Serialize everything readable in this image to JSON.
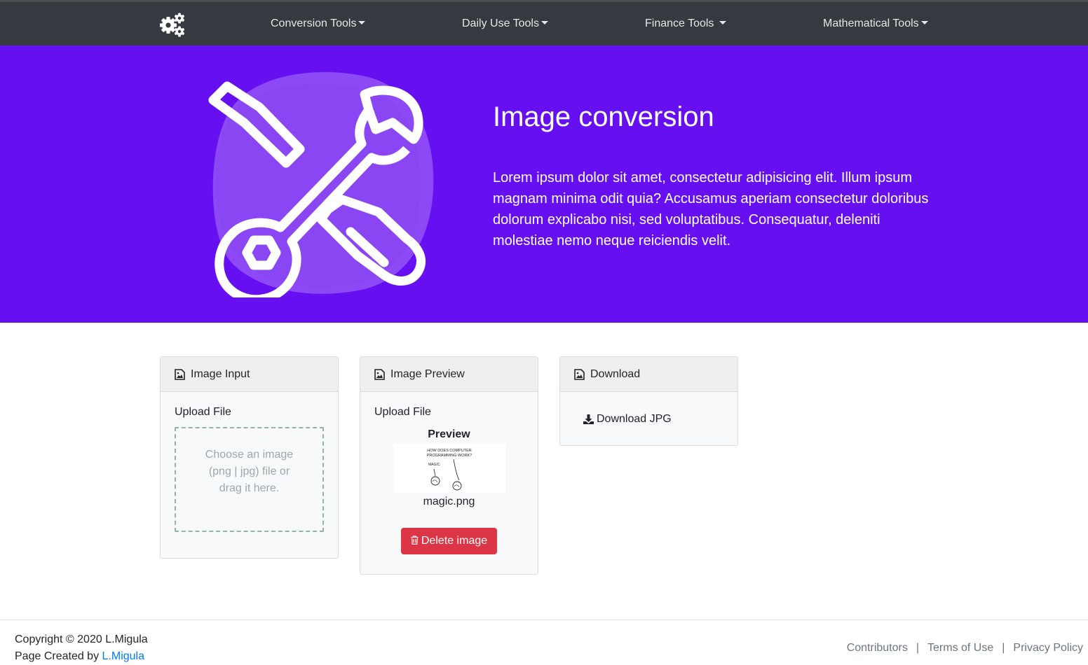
{
  "nav": {
    "items": [
      {
        "label": "Conversion Tools"
      },
      {
        "label": "Daily Use Tools"
      },
      {
        "label": "Finance Tools "
      },
      {
        "label": "Mathematical Tools"
      }
    ]
  },
  "hero": {
    "title": "Image conversion",
    "text": "Lorem ipsum dolor sit amet, consectetur adipisicing elit. Illum ipsum magnam minima odit quia? Accusamus aperiam consectetur doloribus dolorum explicabo nisi, sed voluptatibus. Consequatur, deleniti molestiae nemo neque reiciendis velit."
  },
  "cards": {
    "input": {
      "header": "Image Input",
      "upload_label": "Upload File",
      "dropzone_text": "Choose an image (png | jpg) file or drag it here."
    },
    "preview": {
      "header": "Image Preview",
      "upload_label": "Upload File",
      "preview_title": "Preview",
      "image_caption": "HOW DOES COMPUTER PROGRAMMING WORK?",
      "image_speech": "MAGIC.",
      "file_name": "magic.png",
      "delete_label": "Delete image"
    },
    "download": {
      "header": "Download",
      "link_label": "Download JPG"
    }
  },
  "footer": {
    "copyright": "Copyright © 2020 L.Migula",
    "created_prefix": "Page Created by ",
    "created_author": "L.Migula",
    "links": [
      "Contributors",
      "Terms of Use",
      "Privacy Policy"
    ],
    "separator": "|"
  },
  "colors": {
    "navbar": "#343a40",
    "hero": "#6610f2",
    "danger": "#dc3545",
    "link": "#007bff"
  }
}
